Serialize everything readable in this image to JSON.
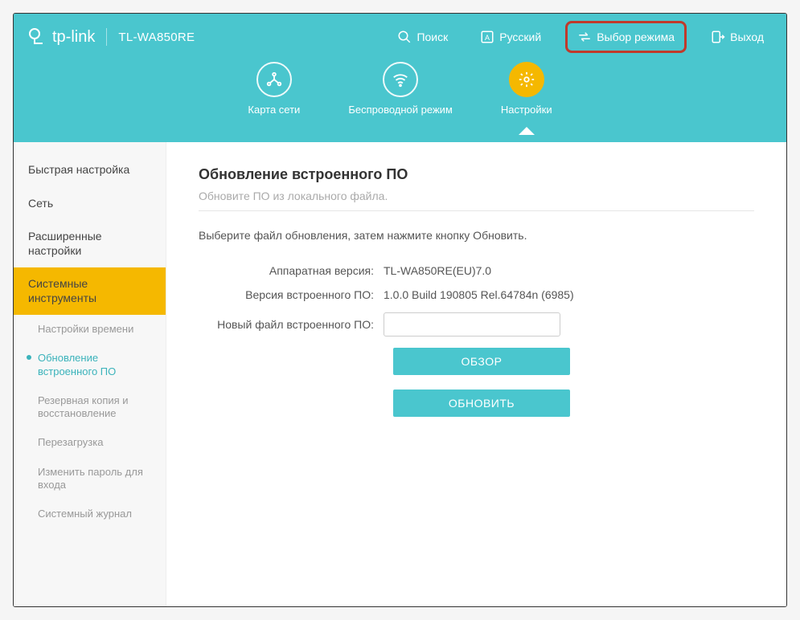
{
  "brand": "tp-link",
  "model": "TL-WA850RE",
  "topActions": {
    "search": "Поиск",
    "language": "Русский",
    "mode": "Выбор режима",
    "logout": "Выход"
  },
  "navTabs": {
    "map": "Карта сети",
    "wireless": "Беспроводной режим",
    "settings": "Настройки"
  },
  "sidebar": {
    "quickSetup": "Быстрая настройка",
    "network": "Сеть",
    "advanced": "Расширенные настройки",
    "systools": "Системные инструменты",
    "sub": {
      "time": "Настройки времени",
      "firmware": "Обновление встроенного ПО",
      "backup": "Резервная копия и восстановление",
      "reboot": "Перезагрузка",
      "password": "Изменить пароль для входа",
      "syslog": "Системный журнал"
    }
  },
  "page": {
    "title": "Обновление встроенного ПО",
    "subtitle": "Обновите ПО из локального файла.",
    "instruction": "Выберите файл обновления, затем нажмите кнопку Обновить."
  },
  "form": {
    "hwLabel": "Аппаратная версия:",
    "hwValue": "TL-WA850RE(EU)7.0",
    "fwLabel": "Версия встроенного ПО:",
    "fwValue": "1.0.0 Build 190805 Rel.64784n (6985)",
    "fileLabel": "Новый файл встроенного ПО:",
    "fileValue": "",
    "browse": "ОБЗОР",
    "update": "ОБНОВИТЬ"
  }
}
